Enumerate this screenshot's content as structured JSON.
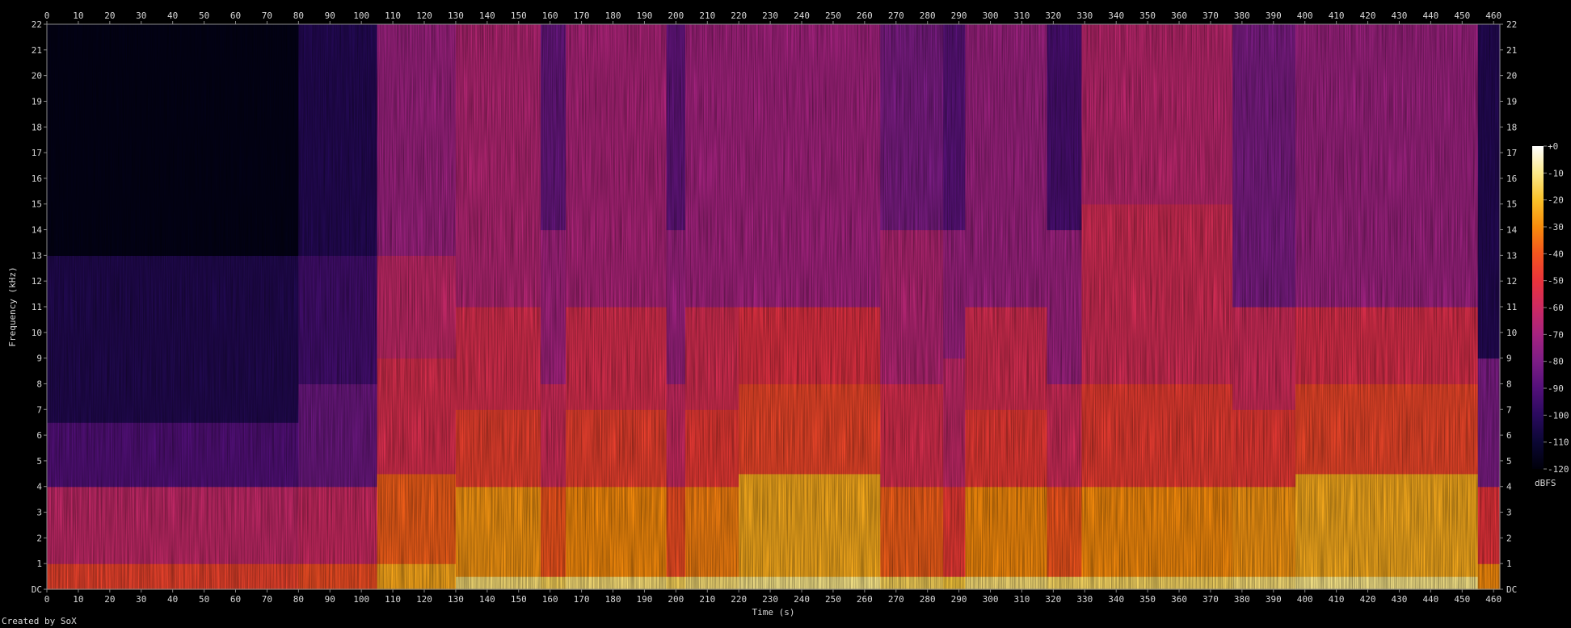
{
  "chart_data": {
    "type": "heatmap",
    "title": "",
    "xlabel": "Time (s)",
    "ylabel": "Frequency (kHz)",
    "xlim": [
      0,
      462
    ],
    "ylim": [
      0,
      22
    ],
    "x_ticks": [
      "0",
      "10",
      "20",
      "30",
      "40",
      "50",
      "60",
      "70",
      "80",
      "90",
      "100",
      "110",
      "120",
      "130",
      "140",
      "150",
      "160",
      "170",
      "180",
      "190",
      "200",
      "210",
      "220",
      "230",
      "240",
      "250",
      "260",
      "270",
      "280",
      "290",
      "300",
      "310",
      "320",
      "330",
      "340",
      "350",
      "360",
      "370",
      "380",
      "390",
      "400",
      "410",
      "420",
      "430",
      "440",
      "450",
      "460"
    ],
    "y_ticks": [
      "DC",
      "1",
      "2",
      "3",
      "4",
      "5",
      "6",
      "7",
      "8",
      "9",
      "10",
      "11",
      "12",
      "13",
      "14",
      "15",
      "16",
      "17",
      "18",
      "19",
      "20",
      "21",
      "22"
    ],
    "colorbar": {
      "label": "dBFS",
      "ticks": [
        "+0",
        "-10",
        "-20",
        "-30",
        "-40",
        "-50",
        "-60",
        "-70",
        "-80",
        "-90",
        "-100",
        "-110",
        "-120"
      ],
      "range": [
        -120,
        0
      ],
      "colors": [
        "#00000a",
        "#0b0734",
        "#2a0a5e",
        "#53107a",
        "#7d1d86",
        "#a62380",
        "#cc2a62",
        "#e9333b",
        "#f4551e",
        "#f88c0c",
        "#fac129",
        "#fce98a",
        "#ffffff"
      ]
    },
    "segments": [
      {
        "t_start": 0,
        "t_end": 80,
        "bands": [
          {
            "f_max": 1,
            "db": -45
          },
          {
            "f_max": 4,
            "db": -62
          },
          {
            "f_max": 6.5,
            "db": -90
          },
          {
            "f_max": 13,
            "db": -103
          },
          {
            "f_max": 22,
            "db": -117
          }
        ]
      },
      {
        "t_start": 80,
        "t_end": 105,
        "bands": [
          {
            "f_max": 1,
            "db": -42
          },
          {
            "f_max": 4,
            "db": -60
          },
          {
            "f_max": 8,
            "db": -84
          },
          {
            "f_max": 13,
            "db": -94
          },
          {
            "f_max": 22,
            "db": -102
          }
        ]
      },
      {
        "t_start": 105,
        "t_end": 130,
        "bands": [
          {
            "f_max": 1,
            "db": -25
          },
          {
            "f_max": 4.5,
            "db": -38
          },
          {
            "f_max": 9,
            "db": -55
          },
          {
            "f_max": 13,
            "db": -62
          },
          {
            "f_max": 22,
            "db": -72
          }
        ]
      },
      {
        "t_start": 130,
        "t_end": 157,
        "bands": [
          {
            "f_max": 0.5,
            "db": -12
          },
          {
            "f_max": 4,
            "db": -28
          },
          {
            "f_max": 7,
            "db": -46
          },
          {
            "f_max": 11,
            "db": -55
          },
          {
            "f_max": 22,
            "db": -66
          }
        ]
      },
      {
        "t_start": 157,
        "t_end": 165,
        "bands": [
          {
            "f_max": 0.5,
            "db": -15
          },
          {
            "f_max": 4,
            "db": -40
          },
          {
            "f_max": 8,
            "db": -58
          },
          {
            "f_max": 14,
            "db": -70
          },
          {
            "f_max": 22,
            "db": -85
          }
        ]
      },
      {
        "t_start": 165,
        "t_end": 197,
        "bands": [
          {
            "f_max": 0.5,
            "db": -12
          },
          {
            "f_max": 4,
            "db": -30
          },
          {
            "f_max": 7,
            "db": -46
          },
          {
            "f_max": 11,
            "db": -55
          },
          {
            "f_max": 22,
            "db": -68
          }
        ]
      },
      {
        "t_start": 197,
        "t_end": 203,
        "bands": [
          {
            "f_max": 0.5,
            "db": -15
          },
          {
            "f_max": 4,
            "db": -42
          },
          {
            "f_max": 8,
            "db": -60
          },
          {
            "f_max": 14,
            "db": -72
          },
          {
            "f_max": 22,
            "db": -86
          }
        ]
      },
      {
        "t_start": 203,
        "t_end": 220,
        "bands": [
          {
            "f_max": 0.5,
            "db": -12
          },
          {
            "f_max": 4,
            "db": -32
          },
          {
            "f_max": 7,
            "db": -48
          },
          {
            "f_max": 11,
            "db": -56
          },
          {
            "f_max": 22,
            "db": -70
          }
        ]
      },
      {
        "t_start": 220,
        "t_end": 265,
        "bands": [
          {
            "f_max": 0.5,
            "db": -10
          },
          {
            "f_max": 4.5,
            "db": -24
          },
          {
            "f_max": 8,
            "db": -44
          },
          {
            "f_max": 11,
            "db": -52
          },
          {
            "f_max": 22,
            "db": -70
          }
        ]
      },
      {
        "t_start": 265,
        "t_end": 285,
        "bands": [
          {
            "f_max": 0.5,
            "db": -15
          },
          {
            "f_max": 4,
            "db": -38
          },
          {
            "f_max": 8,
            "db": -55
          },
          {
            "f_max": 14,
            "db": -66
          },
          {
            "f_max": 22,
            "db": -80
          }
        ]
      },
      {
        "t_start": 285,
        "t_end": 292,
        "bands": [
          {
            "f_max": 0.5,
            "db": -18
          },
          {
            "f_max": 4,
            "db": -48
          },
          {
            "f_max": 9,
            "db": -62
          },
          {
            "f_max": 14,
            "db": -72
          },
          {
            "f_max": 22,
            "db": -88
          }
        ]
      },
      {
        "t_start": 292,
        "t_end": 318,
        "bands": [
          {
            "f_max": 0.5,
            "db": -12
          },
          {
            "f_max": 4,
            "db": -30
          },
          {
            "f_max": 7,
            "db": -48
          },
          {
            "f_max": 11,
            "db": -56
          },
          {
            "f_max": 22,
            "db": -72
          }
        ]
      },
      {
        "t_start": 318,
        "t_end": 329,
        "bands": [
          {
            "f_max": 0.5,
            "db": -14
          },
          {
            "f_max": 4,
            "db": -40
          },
          {
            "f_max": 8,
            "db": -58
          },
          {
            "f_max": 14,
            "db": -72
          },
          {
            "f_max": 22,
            "db": -92
          }
        ]
      },
      {
        "t_start": 329,
        "t_end": 377,
        "bands": [
          {
            "f_max": 0.5,
            "db": -14
          },
          {
            "f_max": 4,
            "db": -30
          },
          {
            "f_max": 8,
            "db": -47
          },
          {
            "f_max": 15,
            "db": -57
          },
          {
            "f_max": 22,
            "db": -64
          }
        ]
      },
      {
        "t_start": 377,
        "t_end": 397,
        "bands": [
          {
            "f_max": 0.5,
            "db": -12
          },
          {
            "f_max": 4,
            "db": -28
          },
          {
            "f_max": 7,
            "db": -48
          },
          {
            "f_max": 11,
            "db": -58
          },
          {
            "f_max": 22,
            "db": -80
          }
        ]
      },
      {
        "t_start": 397,
        "t_end": 455,
        "bands": [
          {
            "f_max": 0.5,
            "db": -10
          },
          {
            "f_max": 4.5,
            "db": -24
          },
          {
            "f_max": 8,
            "db": -44
          },
          {
            "f_max": 11,
            "db": -54
          },
          {
            "f_max": 22,
            "db": -72
          }
        ]
      },
      {
        "t_start": 455,
        "t_end": 462,
        "bands": [
          {
            "f_max": 1,
            "db": -30
          },
          {
            "f_max": 4,
            "db": -50
          },
          {
            "f_max": 9,
            "db": -80
          },
          {
            "f_max": 22,
            "db": -102
          }
        ]
      }
    ]
  },
  "footer": {
    "credit": "Created by SoX"
  }
}
